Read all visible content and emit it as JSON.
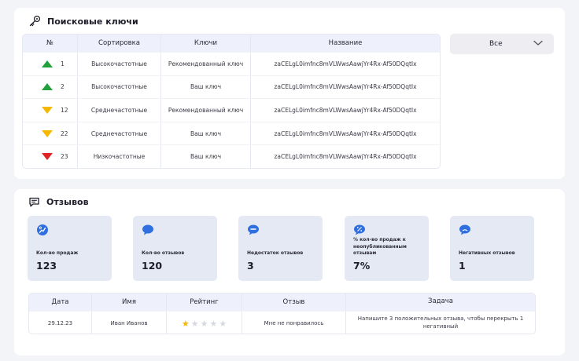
{
  "keys_section": {
    "title": "Поисковые ключи",
    "icon": "key-icon",
    "columns": [
      "№",
      "Сортировка",
      "Ключи",
      "Название"
    ],
    "rows": [
      {
        "trend": "up",
        "trend_color": "#22a03c",
        "num": "1",
        "sort": "Высокочастотные",
        "key": "Рекомендованный ключ",
        "name": "zaCELgL0imfnc8mVLWwsAawjYr4Rx-Af50DQqtIx"
      },
      {
        "trend": "up",
        "trend_color": "#22a03c",
        "num": "2",
        "sort": "Высокочастотные",
        "key": "Ваш ключ",
        "name": "zaCELgL0imfnc8mVLWwsAawjYr4Rx-Af50DQqtIx"
      },
      {
        "trend": "down",
        "trend_color": "#f5b800",
        "num": "12",
        "sort": "Среднечастотные",
        "key": "Рекомендованный ключ",
        "name": "zaCELgL0imfnc8mVLWwsAawjYr4Rx-Af50DQqtIx"
      },
      {
        "trend": "down",
        "trend_color": "#f5b800",
        "num": "22",
        "sort": "Среднечастотные",
        "key": "Ваш ключ",
        "name": "zaCELgL0imfnc8mVLWwsAawjYr4Rx-Af50DQqtIx"
      },
      {
        "trend": "down",
        "trend_color": "#e02424",
        "num": "23",
        "sort": "Низкочастотные",
        "key": "Ваш ключ",
        "name": "zaCELgL0imfnc8mVLWwsAawjYr4Rx-Af50DQqtIx"
      }
    ],
    "filter": {
      "value": "Все",
      "icon": "chevron-down-icon"
    }
  },
  "reviews_section": {
    "title": "Отзывов",
    "icon": "chat-icon",
    "cards": [
      {
        "label": "Кол-во продаж",
        "value": "123",
        "icon": "sales-icon"
      },
      {
        "label": "Кол-во отзывов",
        "value": "120",
        "icon": "comment-icon"
      },
      {
        "label": "Недостаток отзывов",
        "value": "3",
        "icon": "comment-minus-icon"
      },
      {
        "label": "% кол-во продаж к неопубликованным отзывам",
        "value": "7%",
        "icon": "comment-percent-icon"
      },
      {
        "label": "Негативных отзывов",
        "value": "1",
        "icon": "comment-negative-icon"
      }
    ],
    "columns": [
      "Дата",
      "Имя",
      "Рейтинг",
      "Отзыв",
      "Задача"
    ],
    "rows": [
      {
        "date": "29.12.23",
        "name": "Иван Иванов",
        "rating": 1,
        "rating_max": 5,
        "review": "Мне не понравилось",
        "task": "Напишите 3 положительных отзыва, чтобы перекрыть 1 негативный"
      }
    ]
  },
  "colors": {
    "accent": "#2f6fe0",
    "header_bg": "#eef0fb",
    "card_bg": "#e5e9f3",
    "star": "#f5b800"
  }
}
